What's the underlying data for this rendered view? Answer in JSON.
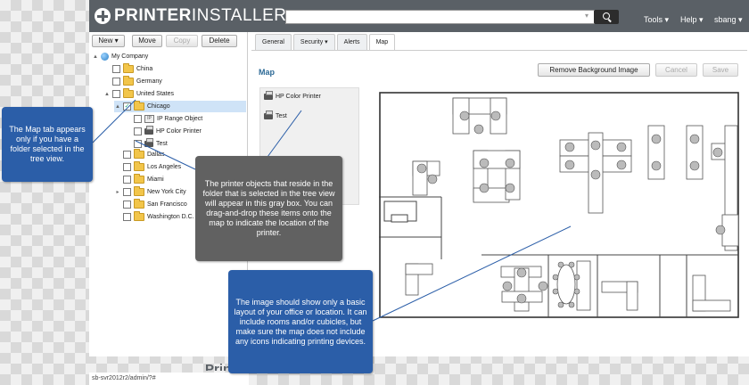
{
  "header": {
    "logo_bold": "PRINTER",
    "logo_light": "INSTALLER",
    "search_placeholder": "",
    "menu": [
      {
        "label": "Tools ▾"
      },
      {
        "label": "Help ▾"
      },
      {
        "label": "sbang ▾"
      }
    ]
  },
  "toolbar": {
    "new_label": "New ▾",
    "move_label": "Move",
    "copy_label": "Copy",
    "delete_label": "Delete"
  },
  "tree": {
    "items": [
      {
        "label": "My Company",
        "expander": "▲",
        "icon": "globe"
      },
      {
        "label": "China",
        "expander": "",
        "icon": "folder"
      },
      {
        "label": "Germany",
        "expander": "",
        "icon": "folder"
      },
      {
        "label": "United States",
        "expander": "▲",
        "icon": "folder"
      },
      {
        "label": "Chicago",
        "expander": "▲",
        "icon": "folder",
        "selected": true,
        "checked": true
      },
      {
        "label": "IP Range Object",
        "expander": "",
        "icon": "ip-range"
      },
      {
        "label": "HP Color Printer",
        "expander": "",
        "icon": "printer"
      },
      {
        "label": "Test",
        "expander": "",
        "icon": "printer"
      },
      {
        "label": "Dallas",
        "expander": "",
        "icon": "folder"
      },
      {
        "label": "Los Angeles",
        "expander": "",
        "icon": "folder"
      },
      {
        "label": "Miami",
        "expander": "",
        "icon": "folder"
      },
      {
        "label": "New York City",
        "expander": "▸",
        "icon": "folder"
      },
      {
        "label": "San Francisco",
        "expander": "",
        "icon": "folder"
      },
      {
        "label": "Washington D.C.",
        "expander": "",
        "icon": "folder"
      }
    ]
  },
  "status_url": "sb-svr2012r2/admin/?#",
  "tabs": [
    {
      "label": "General"
    },
    {
      "label": "Security ▾"
    },
    {
      "label": "Alerts"
    },
    {
      "label": "Map",
      "active": true
    }
  ],
  "map": {
    "title": "Map",
    "remove_bg_label": "Remove Background Image",
    "cancel_label": "Cancel",
    "save_label": "Save",
    "printers": [
      {
        "label": "HP Color Printer"
      },
      {
        "label": "Test"
      }
    ]
  },
  "callouts": {
    "map_tab": "The Map tab appears only if you have a folder selected in the tree view.",
    "printer_objects": "The printer objects that reside in the folder that is selected in the tree view will appear in this gray box. You can drag-and-drop these items onto the map to indicate the location of the printer.",
    "image": "The image should show only a basic layout of your office or location. It can include rooms and/or cubicles, but make sure the map does not include any icons indicating printing devices."
  },
  "colors": {
    "header_bg": "#5a6066",
    "callout_blue": "#2b5ea8",
    "callout_gray": "#616161",
    "title_blue": "#2d6a96",
    "selection": "#cfe3f7"
  }
}
